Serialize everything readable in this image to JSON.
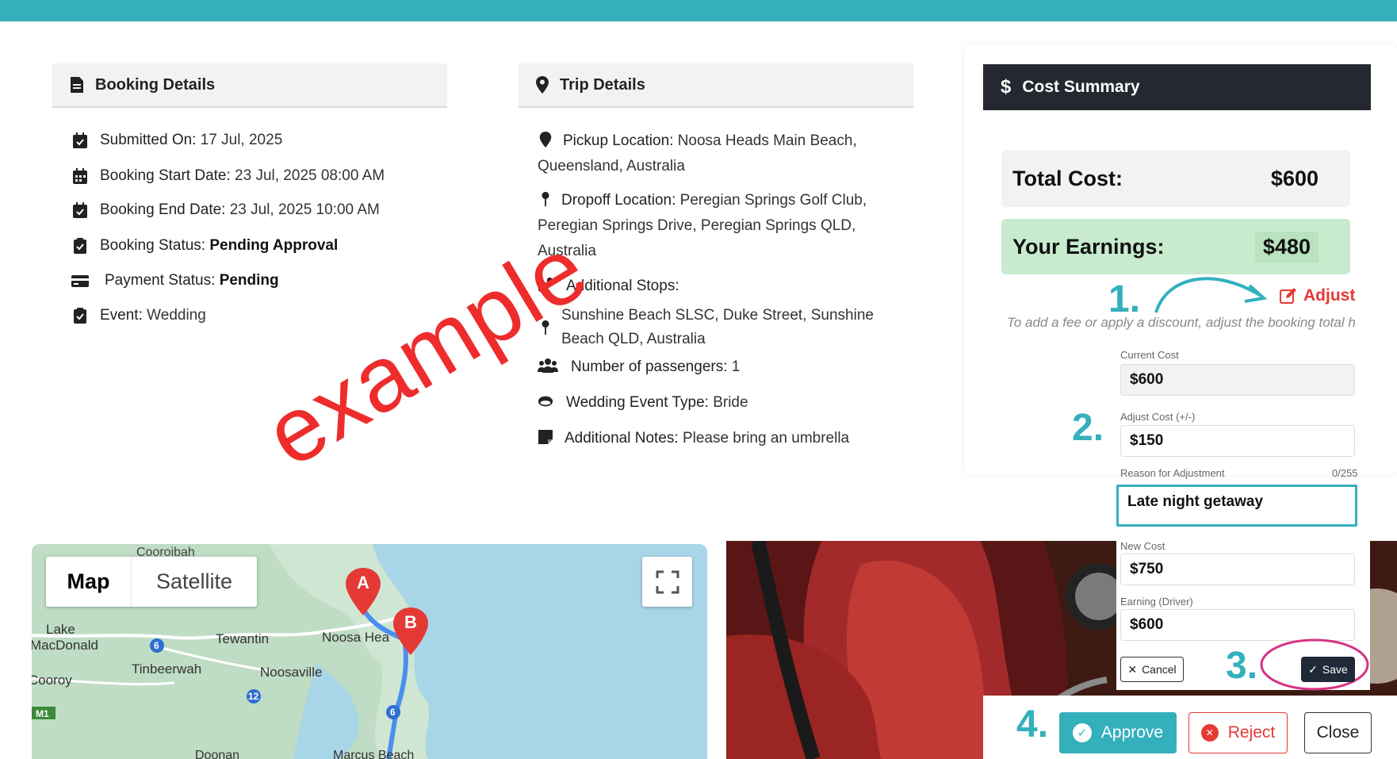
{
  "booking": {
    "title": "Booking Details",
    "submitted_label": "Submitted On:",
    "submitted_value": "17 Jul, 2025",
    "start_label": "Booking Start Date:",
    "start_value": "23 Jul, 2025 08:00 AM",
    "end_label": "Booking End Date:",
    "end_value": "23 Jul, 2025 10:00 AM",
    "status_label": "Booking Status:",
    "status_value": "Pending Approval",
    "payment_label": "Payment Status:",
    "payment_value": "Pending",
    "event_label": "Event:",
    "event_value": "Wedding"
  },
  "trip": {
    "title": "Trip Details",
    "pickup_label": "Pickup Location:",
    "pickup_line1": "Noosa Heads Main Beach,",
    "pickup_line2": "Queensland, Australia",
    "dropoff_label": "Dropoff Location:",
    "dropoff_line1": "Peregian Springs Golf Club,",
    "dropoff_line2": "Peregian Springs Drive, Peregian Springs QLD,",
    "dropoff_line3": "Australia",
    "stops_label": "Additional Stops:",
    "stop_line1": "Sunshine Beach SLSC, Duke Street, Sunshine",
    "stop_line2": "Beach QLD, Australia",
    "passengers_label": "Number of passengers:",
    "passengers_value": "1",
    "wedding_type_label": "Wedding Event Type:",
    "wedding_type_value": "Bride",
    "notes_label": "Additional Notes:",
    "notes_value": "Please bring an umbrella"
  },
  "cost": {
    "title": "Cost Summary",
    "total_label": "Total Cost:",
    "total_value": "$600",
    "earnings_label": "Your Earnings:",
    "earnings_value": "$480",
    "adjust_label": "Adjust",
    "hint": "To add a fee or apply a discount, adjust the booking total here",
    "current_cost_label": "Current Cost",
    "current_cost_value": "$600",
    "adjust_cost_label": "Adjust Cost (+/-)",
    "adjust_cost_value": "$150",
    "reason_label": "Reason for Adjustment",
    "reason_count": "0/255",
    "reason_value": "Late night getaway",
    "new_cost_label": "New Cost",
    "new_cost_value": "$750",
    "earning_driver_label": "Earning (Driver)",
    "earning_driver_value": "$600",
    "cancel_label": "Cancel",
    "save_label": "Save"
  },
  "steps": {
    "s1": "1.",
    "s2": "2.",
    "s3": "3.",
    "s4": "4."
  },
  "actions": {
    "approve": "Approve",
    "reject": "Reject",
    "close": "Close"
  },
  "map": {
    "map_tab": "Map",
    "satellite_tab": "Satellite",
    "marker_a": "A",
    "marker_b": "B",
    "places": [
      "Cooroibah",
      "Lake",
      "MacDonald",
      "Tewantin",
      "Noosa Hea",
      "Tinbeerwah",
      "Noosaville",
      "Cooroy",
      "Doonan",
      "Marcus Beach"
    ],
    "route_shields": [
      "6",
      "12",
      "6"
    ],
    "motorway": "M1"
  },
  "watermark": "example",
  "colors": {
    "accent": "#34b0bd",
    "danger": "#e53935",
    "dark_header": "#252830",
    "earnings_bg": "#c8ebcd"
  }
}
